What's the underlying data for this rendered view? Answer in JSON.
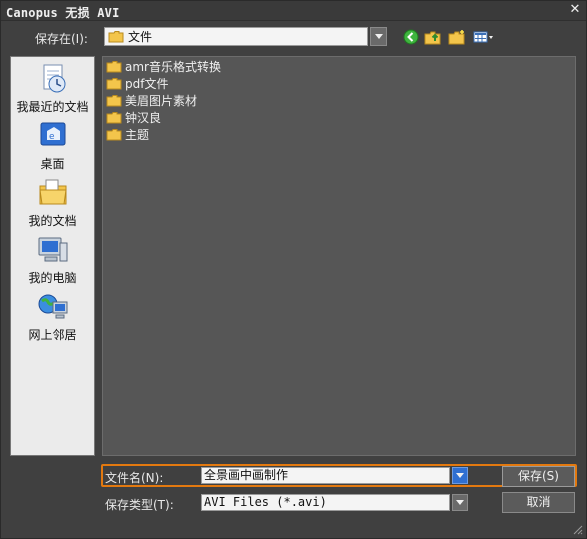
{
  "window": {
    "title": "Canopus 无损 AVI",
    "close_glyph": "✕"
  },
  "toolbar": {
    "lookin_label": "保存在(I):",
    "lookin_value": "文件",
    "icons": [
      "back-arrow-icon",
      "up-folder-icon",
      "new-folder-icon",
      "view-menu-icon"
    ],
    "back_color": "#3fb43f"
  },
  "places": [
    {
      "label": "我最近的文档",
      "icon": "recent-documents-icon"
    },
    {
      "label": "桌面",
      "icon": "desktop-icon"
    },
    {
      "label": "我的文档",
      "icon": "my-documents-icon"
    },
    {
      "label": "我的电脑",
      "icon": "my-computer-icon"
    },
    {
      "label": "网上邻居",
      "icon": "network-places-icon"
    }
  ],
  "files": [
    {
      "name": "amr音乐格式转换"
    },
    {
      "name": "pdf文件"
    },
    {
      "name": "美眉图片素材"
    },
    {
      "name": "钟汉良"
    },
    {
      "name": "主题"
    }
  ],
  "form": {
    "filename_label": "文件名(N):",
    "filename_value": "全景画中画制作",
    "filetype_label": "保存类型(T):",
    "filetype_value": "AVI Files (*.avi)",
    "focus_color": "#e3790f"
  },
  "buttons": {
    "save": "保存(S)",
    "cancel": "取消"
  }
}
